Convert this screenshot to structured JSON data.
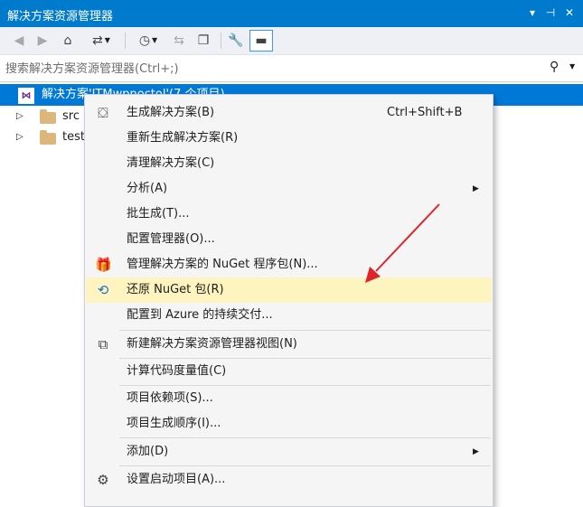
{
  "panel": {
    "title": "解决方案资源管理器",
    "pin_label": "▾ ⊣ ×"
  },
  "toolbar": {
    "back_icon": "back-arrow-icon",
    "forward_icon": "forward-arrow-icon",
    "home_icon": "home-icon",
    "sync_icon": "sync-with-document-icon",
    "history_icon": "pending-changes-icon",
    "refresh_icon": "refresh-icon",
    "collapse_icon": "collapse-all-icon",
    "properties_icon": "wrench-icon",
    "preview_icon": "preview-icon"
  },
  "search": {
    "placeholder": "搜索解决方案资源管理器(Ctrl+;)"
  },
  "tree": {
    "solution_label": "解决方案'JTMwpnoctol'(7 个项目)",
    "items": [
      {
        "label": "src"
      },
      {
        "label": "test"
      }
    ]
  },
  "context_menu": {
    "items": [
      {
        "label": "生成解决方案(B)",
        "shortcut": "Ctrl+Shift+B",
        "icon": "build-icon"
      },
      {
        "label": "重新生成解决方案(R)"
      },
      {
        "label": "清理解决方案(C)"
      },
      {
        "label": "分析(A)",
        "submenu": true
      },
      {
        "label": "批生成(T)..."
      },
      {
        "label": "配置管理器(O)..."
      },
      {
        "label": "管理解决方案的 NuGet 程序包(N)...",
        "icon": "nuget-package-icon"
      },
      {
        "label": "还原 NuGet 包(R)",
        "icon": "restore-icon",
        "highlighted": true
      },
      {
        "label": "配置到 Azure 的持续交付..."
      },
      {
        "label": "新建解决方案资源管理器视图(N)",
        "icon": "new-view-icon"
      },
      {
        "label": "计算代码度量值(C)"
      },
      {
        "label": "项目依赖项(S)..."
      },
      {
        "label": "项目生成顺序(I)..."
      },
      {
        "label": "添加(D)",
        "submenu": true
      },
      {
        "label": "设置启动项目(A)...",
        "icon": "gear-icon"
      }
    ],
    "submenu_glyph": "▶"
  },
  "colors": {
    "title_bg": "#007acc",
    "selection_bg": "#0078d7",
    "menu_bg": "#f5f5f5",
    "highlight_bg": "#fdf4bf",
    "annotation_arrow": "#e0242a"
  }
}
